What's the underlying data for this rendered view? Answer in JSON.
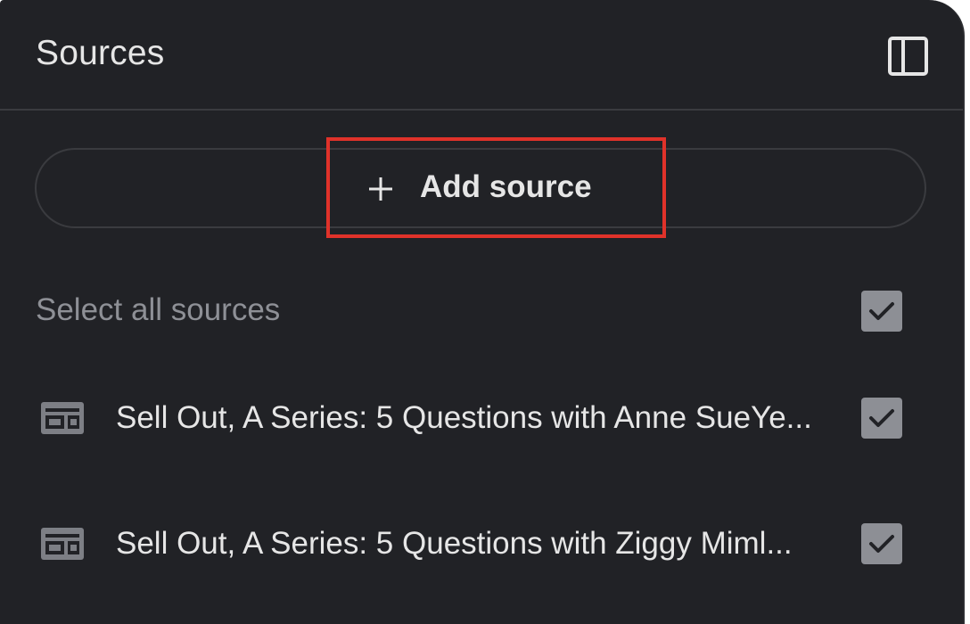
{
  "panel": {
    "title": "Sources",
    "toggle_icon": "panel-left-icon"
  },
  "add_source": {
    "icon": "plus-icon",
    "label": "Add source"
  },
  "select_all": {
    "label": "Select all sources",
    "checked": true
  },
  "sources": [
    {
      "icon": "web-article-icon",
      "title": "Sell Out, A Series: 5 Questions with Anne SueYe...",
      "checked": true
    },
    {
      "icon": "web-article-icon",
      "title": "Sell Out, A Series: 5 Questions with Ziggy Miml...",
      "checked": true
    }
  ],
  "colors": {
    "panel_bg": "#212226",
    "text": "#e6e6e6",
    "muted_text": "#8e9096",
    "checkbox_bg": "#8d8f95",
    "highlight": "#e0322a"
  }
}
